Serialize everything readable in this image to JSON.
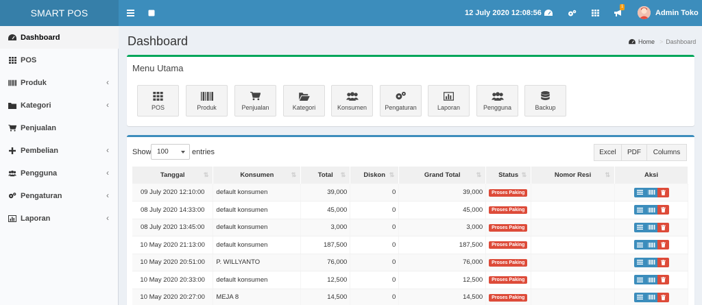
{
  "header": {
    "logo": "SMART POS",
    "datetime": "12 July 2020 12:08:56",
    "notif_count": "1",
    "user_name": "Admin Toko"
  },
  "sidebar": {
    "items": [
      {
        "label": "Dashboard",
        "icon": "dashboard-icon",
        "active": true,
        "chevron": false
      },
      {
        "label": "POS",
        "icon": "grid-icon",
        "active": false,
        "chevron": false
      },
      {
        "label": "Produk",
        "icon": "barcode-icon",
        "active": false,
        "chevron": true
      },
      {
        "label": "Kategori",
        "icon": "folder-icon",
        "active": false,
        "chevron": true
      },
      {
        "label": "Penjualan",
        "icon": "cart-icon",
        "active": false,
        "chevron": false
      },
      {
        "label": "Pembelian",
        "icon": "plus-icon",
        "active": false,
        "chevron": true
      },
      {
        "label": "Pengguna",
        "icon": "users-icon",
        "active": false,
        "chevron": true
      },
      {
        "label": "Pengaturan",
        "icon": "cogs-icon",
        "active": false,
        "chevron": true
      },
      {
        "label": "Laporan",
        "icon": "bar-chart-icon",
        "active": false,
        "chevron": true
      }
    ]
  },
  "page": {
    "title": "Dashboard",
    "breadcrumb_home": "Home",
    "breadcrumb_current": "Dashboard"
  },
  "menu_box": {
    "title": "Menu Utama",
    "tiles": [
      {
        "label": "POS",
        "icon": "grid-icon"
      },
      {
        "label": "Produk",
        "icon": "barcode-icon"
      },
      {
        "label": "Penjualan",
        "icon": "cart-icon"
      },
      {
        "label": "Kategori",
        "icon": "folder-open-icon"
      },
      {
        "label": "Konsumen",
        "icon": "users-icon"
      },
      {
        "label": "Pengaturan",
        "icon": "cogs-icon"
      },
      {
        "label": "Laporan",
        "icon": "bar-chart-icon"
      },
      {
        "label": "Pengguna",
        "icon": "users-icon"
      },
      {
        "label": "Backup",
        "icon": "database-icon"
      }
    ]
  },
  "table_box": {
    "show_label": "Show",
    "page_size": "100",
    "entries_label": "entries",
    "buttons": [
      "Excel",
      "PDF",
      "Columns"
    ],
    "columns": [
      "Tanggal",
      "Konsumen",
      "Total",
      "Diskon",
      "Grand Total",
      "Status",
      "Nomor Resi",
      "Aksi"
    ],
    "rows": [
      {
        "tanggal": "09 July 2020 12:10:00",
        "konsumen": "default konsumen",
        "total": "39,000",
        "diskon": "0",
        "grand_total": "39,000",
        "status": "Proses Paking",
        "resi": ""
      },
      {
        "tanggal": "08 July 2020 14:33:00",
        "konsumen": "default konsumen",
        "total": "45,000",
        "diskon": "0",
        "grand_total": "45,000",
        "status": "Proses Paking",
        "resi": ""
      },
      {
        "tanggal": "08 July 2020 13:45:00",
        "konsumen": "default konsumen",
        "total": "3,000",
        "diskon": "0",
        "grand_total": "3,000",
        "status": "Proses Paking",
        "resi": ""
      },
      {
        "tanggal": "10 May 2020 21:13:00",
        "konsumen": "default konsumen",
        "total": "187,500",
        "diskon": "0",
        "grand_total": "187,500",
        "status": "Proses Paking",
        "resi": ""
      },
      {
        "tanggal": "10 May 2020 20:51:00",
        "konsumen": "P. WILLYANTO",
        "total": "76,000",
        "diskon": "0",
        "grand_total": "76,000",
        "status": "Proses Paking",
        "resi": ""
      },
      {
        "tanggal": "10 May 2020 20:33:00",
        "konsumen": "default konsumen",
        "total": "12,500",
        "diskon": "0",
        "grand_total": "12,500",
        "status": "Proses Paking",
        "resi": ""
      },
      {
        "tanggal": "10 May 2020 20:27:00",
        "konsumen": "MEJA 8",
        "total": "14,500",
        "diskon": "0",
        "grand_total": "14,500",
        "status": "Proses Paking",
        "resi": ""
      }
    ]
  },
  "colors": {
    "header": "#3c8dbc",
    "logo_bg": "#367fa9",
    "menu_box_border": "#00a65a",
    "status_badge": "#dd4b39",
    "action_blue": "#3c8dbc",
    "action_red": "#dd4b39"
  }
}
